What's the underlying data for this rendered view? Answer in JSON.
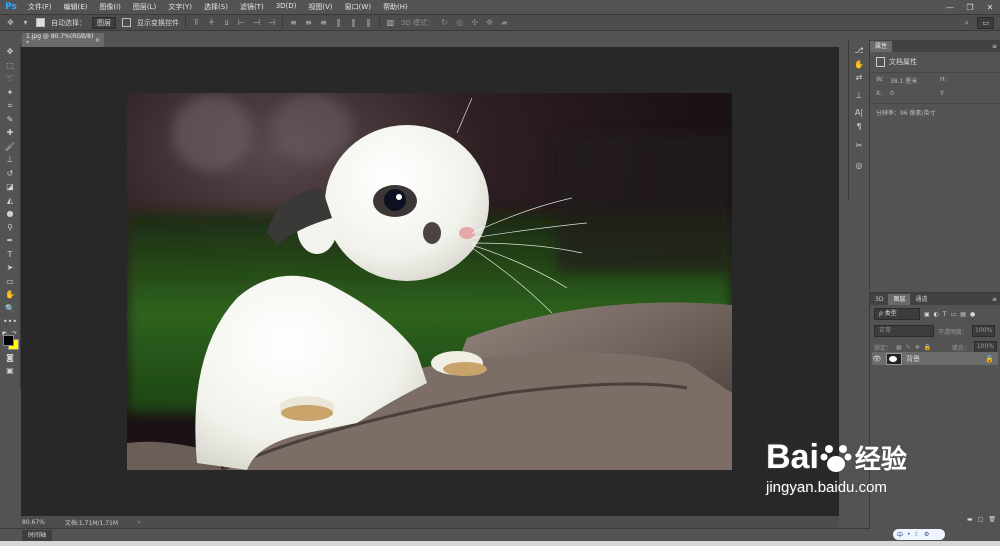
{
  "app": {
    "logo": "Ps"
  },
  "menu": [
    "文件(F)",
    "编辑(E)",
    "图像(I)",
    "图层(L)",
    "文字(Y)",
    "选择(S)",
    "滤镜(T)",
    "3D(D)",
    "视图(V)",
    "窗口(W)",
    "帮助(H)"
  ],
  "window_controls": [
    "—",
    "❐",
    "✕"
  ],
  "options": {
    "auto_select_label": "自动选择：",
    "auto_select_value": "图层",
    "show_transform_label": "显示变换控件",
    "mode_3d_label": "3D 模式："
  },
  "document": {
    "tab_label": "1.jpg @ 80.7%(RGB/8) *",
    "close": "×"
  },
  "status": {
    "zoom": "80.67%",
    "doc_info": "文档:1.71M/1.71M",
    "arrow": "›"
  },
  "timeline": {
    "tab_label": "时间轴"
  },
  "properties": {
    "tab_label": "属性",
    "doc_props_label": "文档属性",
    "w_label": "W:",
    "w_value": "38.1 厘米",
    "h_label": "H:",
    "x_label": "X:",
    "x_value": "0",
    "y_label": "Y:",
    "resolution": "分辨率：96 像素/英寸"
  },
  "layers": {
    "tabs": [
      "3D",
      "图层",
      "通道"
    ],
    "kind_label": "ρ 类型",
    "blend_mode": "正常",
    "opacity_label": "不透明度：",
    "opacity_value": "100%",
    "lock_label": "锁定：",
    "fill_label": "填充：",
    "fill_value": "100%",
    "layer_name": "背景"
  },
  "ime": {
    "lang": "中"
  },
  "watermark": {
    "brand": "Bai",
    "brand2": "经验",
    "url": "jingyan.baidu.com"
  },
  "colors": {
    "accent": "#31a8ff",
    "fg_swatch": "#000000",
    "bg_swatch": "#ffff00"
  }
}
